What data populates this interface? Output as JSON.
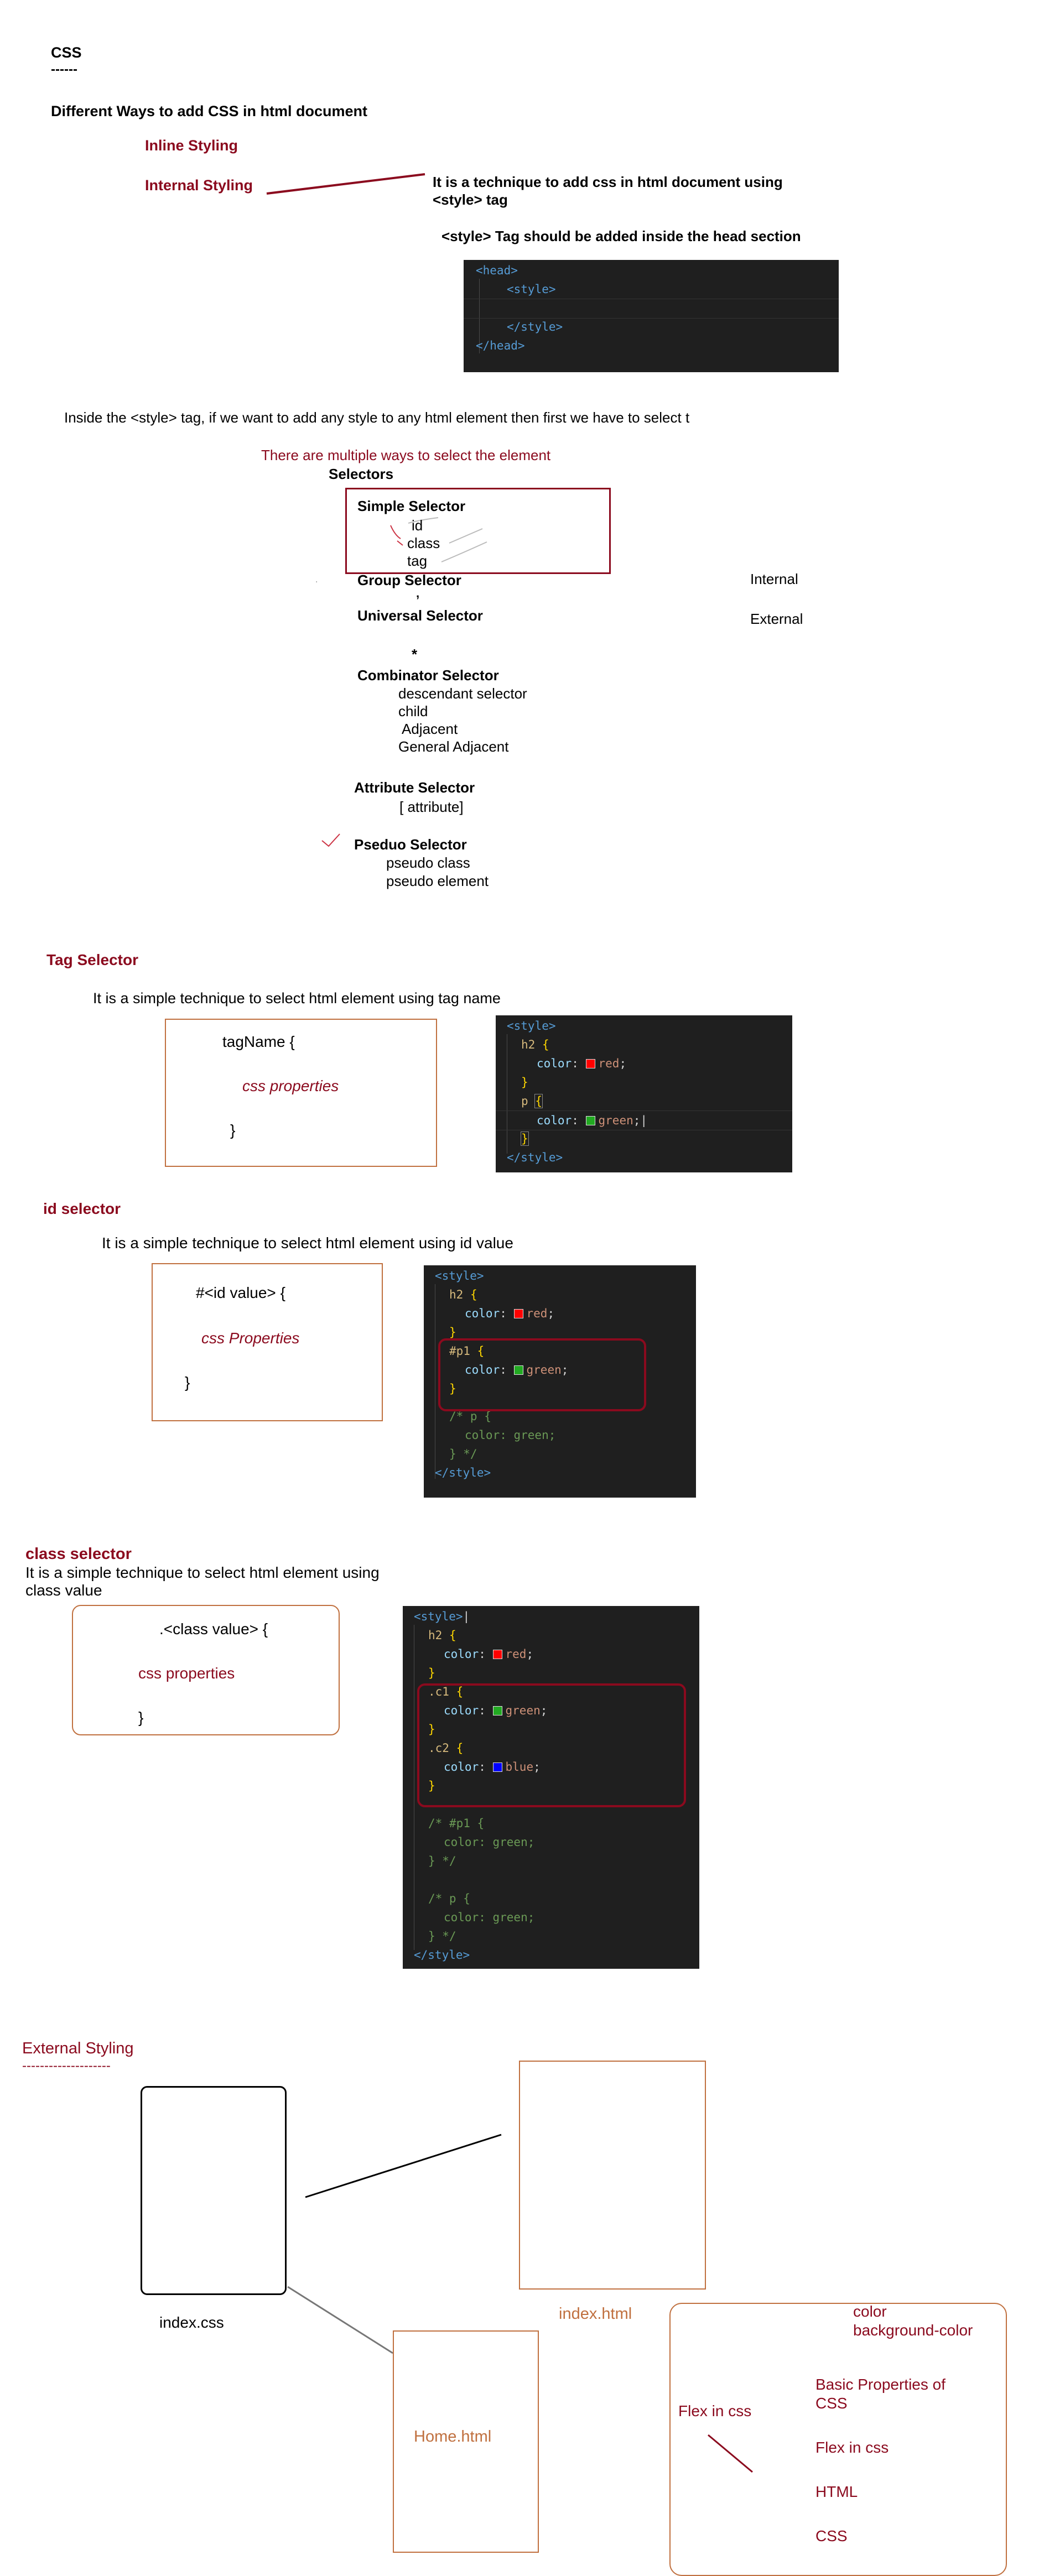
{
  "heading": {
    "title": "CSS",
    "underline": "------",
    "ways": "Different Ways to add CSS in html document"
  },
  "ways": {
    "inline": "Inline Styling",
    "internal": "Internal Styling"
  },
  "internal_note": {
    "line1": "It is a technique to add css in html document using",
    "line2": "<style> tag",
    "head_note": "<style> Tag should be added inside the head section"
  },
  "head_code": [
    "<head>",
    "<style>",
    "",
    "</style>",
    "</head>"
  ],
  "select_note": "Inside the <style> tag, if we want to add any style to any html element then first we have to select t",
  "multiple_ways": "There are multiple ways to select the element",
  "selectors": {
    "title": "Selectors",
    "simple": "Simple Selector",
    "simple_items": [
      "id",
      "class",
      "tag"
    ],
    "group": "Group Selector",
    "group_mark": ",",
    "universal": "Universal Selector",
    "universal_mark": "*",
    "combinator": "Combinator Selector",
    "combinator_items": [
      "descendant selector",
      "child",
      "Adjacent",
      "General Adjacent"
    ],
    "attribute": "Attribute Selector",
    "attribute_item": "[ attribute]",
    "pseudo": "Pseduo Selector",
    "pseudo_items": [
      "pseudo class",
      "pseudo element"
    ]
  },
  "side_labels": {
    "internal": "Internal",
    "external": "External"
  },
  "tag_selector": {
    "title": "Tag Selector",
    "desc": "It is a simple technique to select html element using tag name",
    "box": [
      "tagName {",
      "css properties",
      "}"
    ]
  },
  "id_selector": {
    "title": "id selector",
    "desc": "It is a simple technique to select html element using id value",
    "box": [
      "#<id value> {",
      "css Properties",
      "}"
    ]
  },
  "class_selector": {
    "title": "class selector",
    "desc1": "It is a simple technique to select  html element using",
    "desc2": "class value",
    "box": [
      ".<class value> {",
      "css properties",
      "}"
    ]
  },
  "code": {
    "style_open": "<style>",
    "style_close": "</style>",
    "h2": "h2",
    "p": "p",
    "p1": "#p1",
    "c1": ".c1",
    "c2": ".c2",
    "brace_open": "{",
    "brace_close": "}",
    "color_prop": "color",
    "red": "red",
    "green": "green",
    "blue": "blue",
    "c_p1": "/* #p1 {",
    "c_p": "/* p {",
    "c_green": "color: green;",
    "c_end": "} */"
  },
  "external": {
    "title": "External Styling",
    "underline": "--------------------",
    "index_css": "index.css",
    "index_html": "index.html",
    "home_html": "Home.html"
  },
  "notes_box": {
    "flex_left": "Flex in css",
    "color": "color",
    "bg": "background-color",
    "basic1": "Basic Properties of",
    "basic2": "CSS",
    "flex": "Flex in css",
    "html": "HTML",
    "css": "CSS"
  },
  "colors": {
    "accent": "#8b0a1e",
    "box_orange": "#c0703f",
    "code_bg": "#1f1f1f",
    "swatch_red": "#ff0000",
    "swatch_green": "#22aa22",
    "swatch_blue": "#0000ff"
  }
}
